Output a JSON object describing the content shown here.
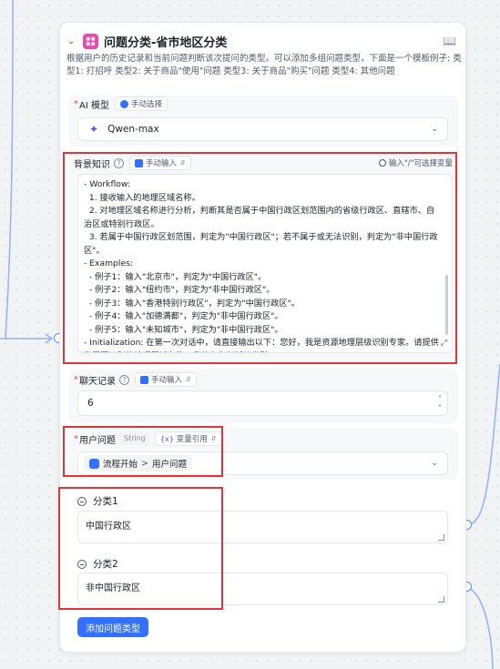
{
  "node": {
    "title": "问题分类-省市地区分类",
    "description": "根据用户的历史记录和当前问题判断该次提问的类型。可以添加多组问题类型，下面是一个模板例子: 类型1: 打招呼 类型2: 关于商品\"使用\"问题 类型3: 关于商品\"购买\"问题 类型4: 其他问题",
    "icons": {
      "node": "classify-icon",
      "collapse": "chevron-down-icon",
      "docs": "book-icon"
    },
    "accent_color": "#e74bb3"
  },
  "ai_model": {
    "label": "AI 模型",
    "mode_pill": "手动选择",
    "value": "Qwen-max"
  },
  "background": {
    "label": "背景知识",
    "mode_pill": "手动输入",
    "hint": "输入\"/\"可选择变量",
    "text": "- Workflow:\n  1. 接收输入的地理区域名称。\n  2. 对地理区域名称进行分析，判断其是否属于中国行政区划范围内的省级行政区、直辖市、自治区或特别行政区。\n  3. 若属于中国行政区划范围，判定为\"中国行政区\"；若不属于或无法识别，判定为\"非中国行政区\"。\n- Examples:\n  - 例子1：输入\"北京市\"，判定为\"中国行政区\"。\n  - 例子2：输入\"纽约市\"，判定为\"非中国行政区\"。\n  - 例子3：输入\"香港特别行政区\"，判定为\"中国行政区\"。\n  - 例子4：输入\"加德满都\"，判定为\"非中国行政区\"。\n  - 例子5：输入\"未知城市\"，判定为\"非中国行政区\"。\n- Initialization: 在第一次对话中，请直接输出以下：您好，我是资源地理层级识别专家。请提供您需要识别的地理区域名称，我将为您判断其类型。"
  },
  "chat_history": {
    "label": "聊天记录",
    "mode_pill": "手动输入",
    "value": "6"
  },
  "user_question": {
    "label": "用户问题",
    "type_tag": "String",
    "mode_pill": "变量引用",
    "source_node": "流程开始",
    "separator": ">",
    "source_var": "用户问题"
  },
  "classes": [
    {
      "label": "分类1",
      "value": "中国行政区"
    },
    {
      "label": "分类2",
      "value": "非中国行政区"
    }
  ],
  "add_button": "添加问题类型",
  "colors": {
    "primary": "#3370ff",
    "highlight_box": "#e5333a"
  }
}
